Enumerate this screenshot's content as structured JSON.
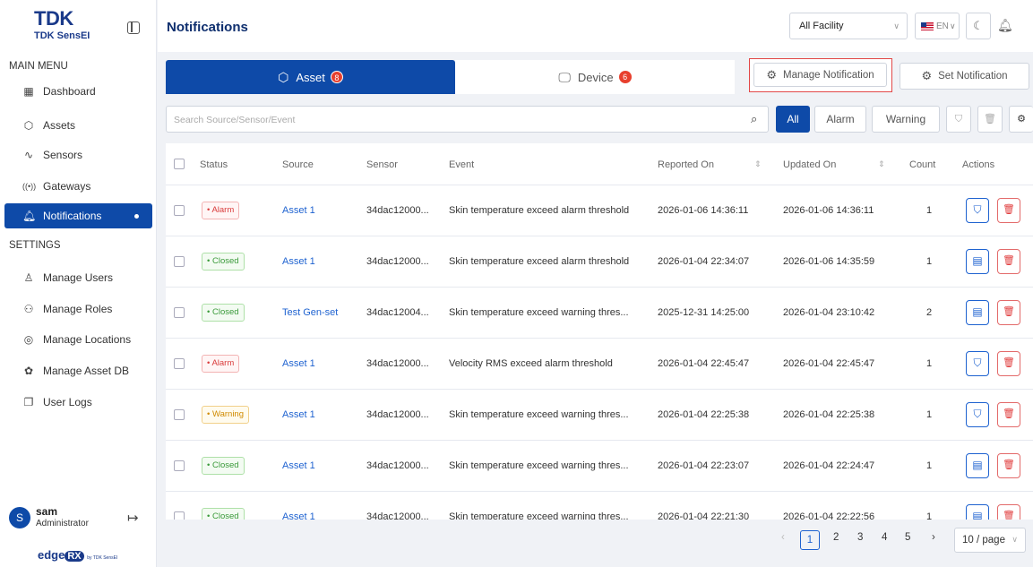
{
  "brand": {
    "logo": "TDK",
    "sub": "TDK SensEI"
  },
  "sidebar": {
    "main_menu_label": "MAIN MENU",
    "main_items": [
      {
        "label": "Dashboard",
        "icon": "dashboard-icon"
      },
      {
        "label": "Assets",
        "icon": "cube-icon"
      },
      {
        "label": "Sensors",
        "icon": "pulse-icon"
      },
      {
        "label": "Gateways",
        "icon": "signal-icon"
      },
      {
        "label": "Notifications",
        "icon": "bell-icon",
        "active": true
      }
    ],
    "settings_label": "SETTINGS",
    "settings_items": [
      {
        "label": "Manage Users",
        "icon": "user-icon"
      },
      {
        "label": "Manage Roles",
        "icon": "users-icon"
      },
      {
        "label": "Manage Locations",
        "icon": "location-pin-icon"
      },
      {
        "label": "Manage Asset DB",
        "icon": "database-icon"
      },
      {
        "label": "User Logs",
        "icon": "log-icon"
      }
    ],
    "user": {
      "initial": "S",
      "name": "sam",
      "role": "Administrator"
    },
    "footer_logo": "edge",
    "footer_logo_rx": "RX",
    "footer_logo_by": "by TDK SensEI"
  },
  "header": {
    "title": "Notifications",
    "facility": "All Facility",
    "language": "EN"
  },
  "tabs": [
    {
      "label": "Asset",
      "count": "8"
    },
    {
      "label": "Device",
      "count": "6"
    }
  ],
  "actions": {
    "manage_notification": "Manage Notification",
    "set_notification": "Set Notification"
  },
  "search": {
    "placeholder": "Search Source/Sensor/Event"
  },
  "filters": {
    "all": "All",
    "alarm": "Alarm",
    "warning": "Warning"
  },
  "table": {
    "columns": {
      "status": "Status",
      "source": "Source",
      "sensor": "Sensor",
      "event": "Event",
      "reported_on": "Reported On",
      "updated_on": "Updated On",
      "count": "Count",
      "actions": "Actions"
    },
    "rows": [
      {
        "status": "Alarm",
        "source": "Asset 1",
        "sensor": "34dac12000...",
        "event": "Skin temperature exceed alarm threshold",
        "reported_on": "2026-01-06 14:36:11",
        "updated_on": "2026-01-06 14:36:11",
        "count": "1"
      },
      {
        "status": "Closed",
        "source": "Asset 1",
        "sensor": "34dac12000...",
        "event": "Skin temperature exceed alarm threshold",
        "reported_on": "2026-01-04 22:34:07",
        "updated_on": "2026-01-06 14:35:59",
        "count": "1"
      },
      {
        "status": "Closed",
        "source": "Test Gen-set",
        "sensor": "34dac12004...",
        "event": "Skin temperature exceed warning thres...",
        "reported_on": "2025-12-31 14:25:00",
        "updated_on": "2026-01-04 23:10:42",
        "count": "2"
      },
      {
        "status": "Alarm",
        "source": "Asset 1",
        "sensor": "34dac12000...",
        "event": "Velocity RMS exceed alarm threshold",
        "reported_on": "2026-01-04 22:45:47",
        "updated_on": "2026-01-04 22:45:47",
        "count": "1"
      },
      {
        "status": "Warning",
        "source": "Asset 1",
        "sensor": "34dac12000...",
        "event": "Skin temperature exceed warning thres...",
        "reported_on": "2026-01-04 22:25:38",
        "updated_on": "2026-01-04 22:25:38",
        "count": "1"
      },
      {
        "status": "Closed",
        "source": "Asset 1",
        "sensor": "34dac12000...",
        "event": "Skin temperature exceed warning thres...",
        "reported_on": "2026-01-04 22:23:07",
        "updated_on": "2026-01-04 22:24:47",
        "count": "1"
      },
      {
        "status": "Closed",
        "source": "Asset 1",
        "sensor": "34dac12000...",
        "event": "Skin temperature exceed warning thres...",
        "reported_on": "2026-01-04 22:21:30",
        "updated_on": "2026-01-04 22:22:56",
        "count": "1"
      }
    ]
  },
  "pagination": {
    "pages": [
      "1",
      "2",
      "3",
      "4",
      "5"
    ],
    "current": "1",
    "page_size": "10 / page"
  }
}
